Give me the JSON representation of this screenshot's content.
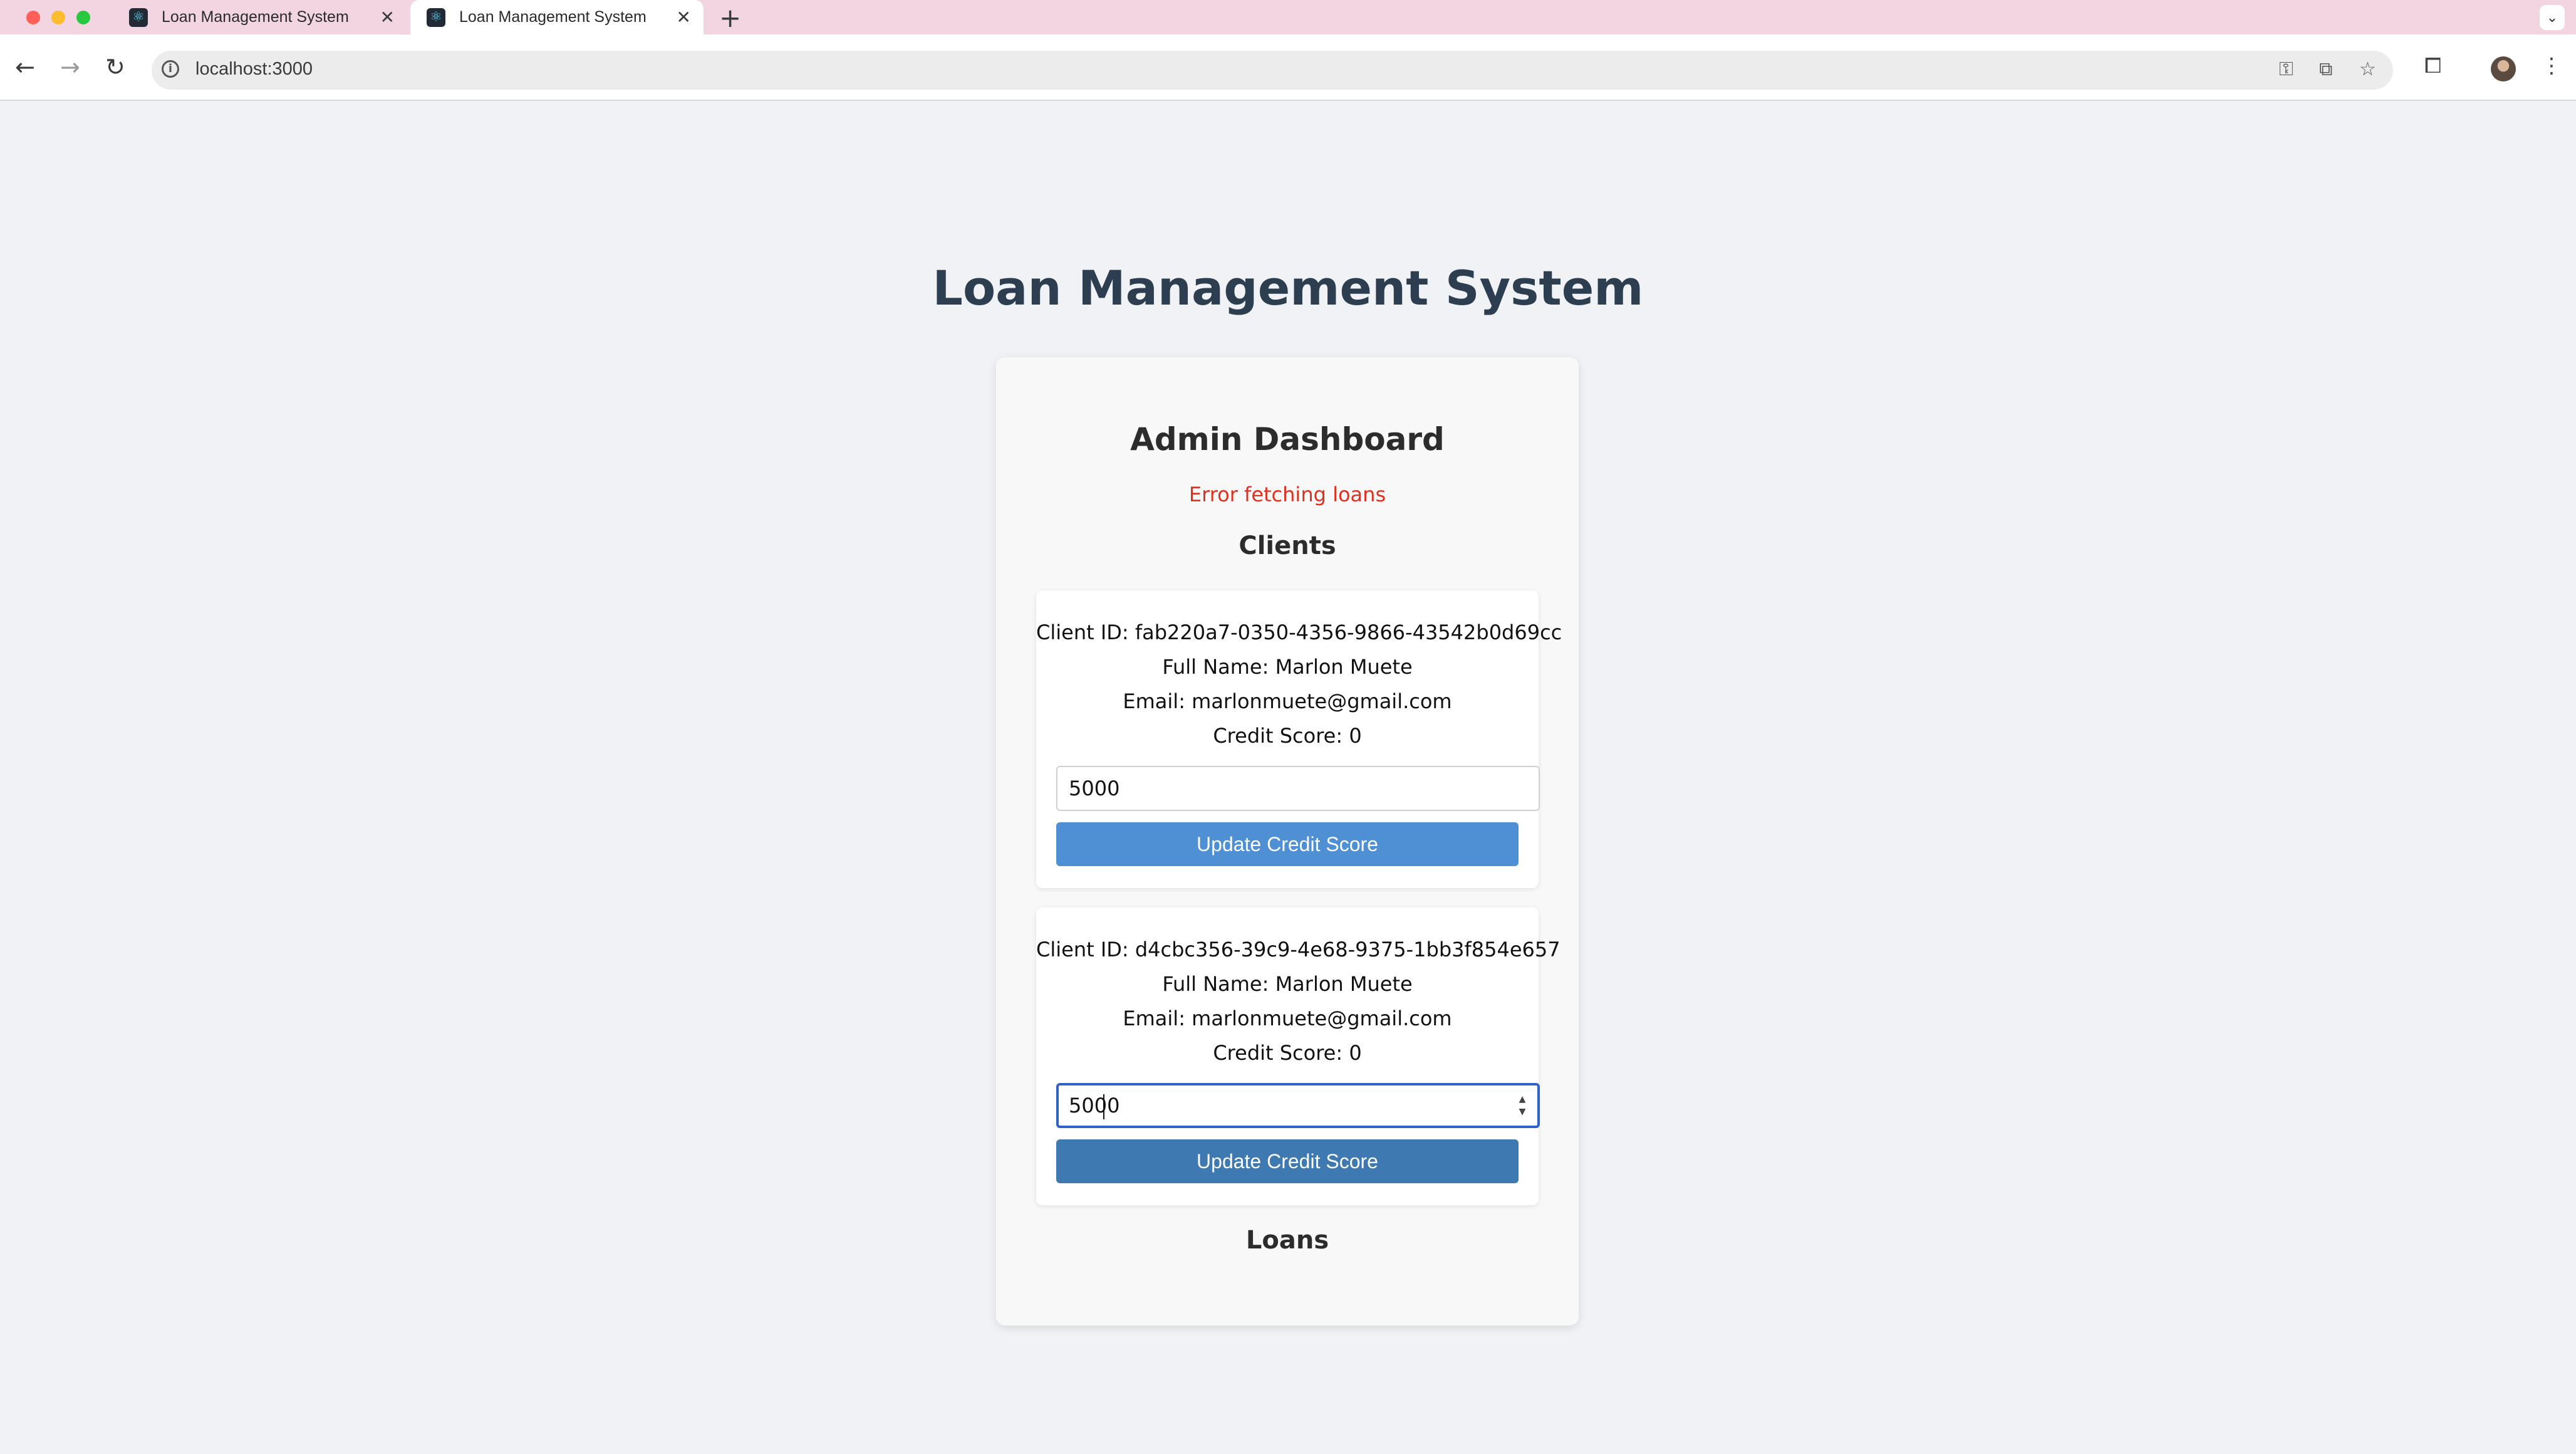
{
  "browser": {
    "tabs": [
      {
        "title": "Loan Management System",
        "close": "✕"
      },
      {
        "title": "Loan Management System",
        "close": "✕"
      }
    ],
    "new_tab": "+",
    "tab_menu": "⌄",
    "nav": {
      "back": "←",
      "forward": "→",
      "reload": "↻"
    },
    "url": "localhost:3000",
    "info_icon": "i",
    "icons": [
      "key-icon",
      "install-icon",
      "star-icon",
      "extensions-icon",
      "profile-avatar",
      "menu-icon"
    ],
    "traffic_colors": [
      "#ff5f57",
      "#febc2e",
      "#28c840"
    ]
  },
  "page": {
    "title": "Loan Management System"
  },
  "dashboard": {
    "title": "Admin Dashboard",
    "error": "Error fetching loans",
    "clients_heading": "Clients",
    "loans_heading": "Loans",
    "clients": [
      {
        "id_line": "Client ID: fab220a7-0350-4356-9866-43542b0d69cc",
        "name_line": "Full Name: Marlon Muete",
        "email_line": "Email: marlonmuete@gmail.com",
        "score_line": "Credit Score: 0",
        "input_value": "5000",
        "button_label": "Update Credit Score",
        "button_color": "#4f8fd3",
        "focused": false
      },
      {
        "id_line": "Client ID: d4cbc356-39c9-4e68-9375-1bb3f854e657",
        "name_line": "Full Name: Marlon Muete",
        "email_line": "Email: marlonmuete@gmail.com",
        "score_line": "Credit Score: 0",
        "input_value": "5000",
        "button_label": "Update Credit Score",
        "button_color": "#3f79b2",
        "focused": true
      }
    ]
  },
  "colors": {
    "page_bg": "#f0f2f5",
    "title": "#2c3e50",
    "error": "#e0301e",
    "focus_ring": "#2f62c9"
  }
}
